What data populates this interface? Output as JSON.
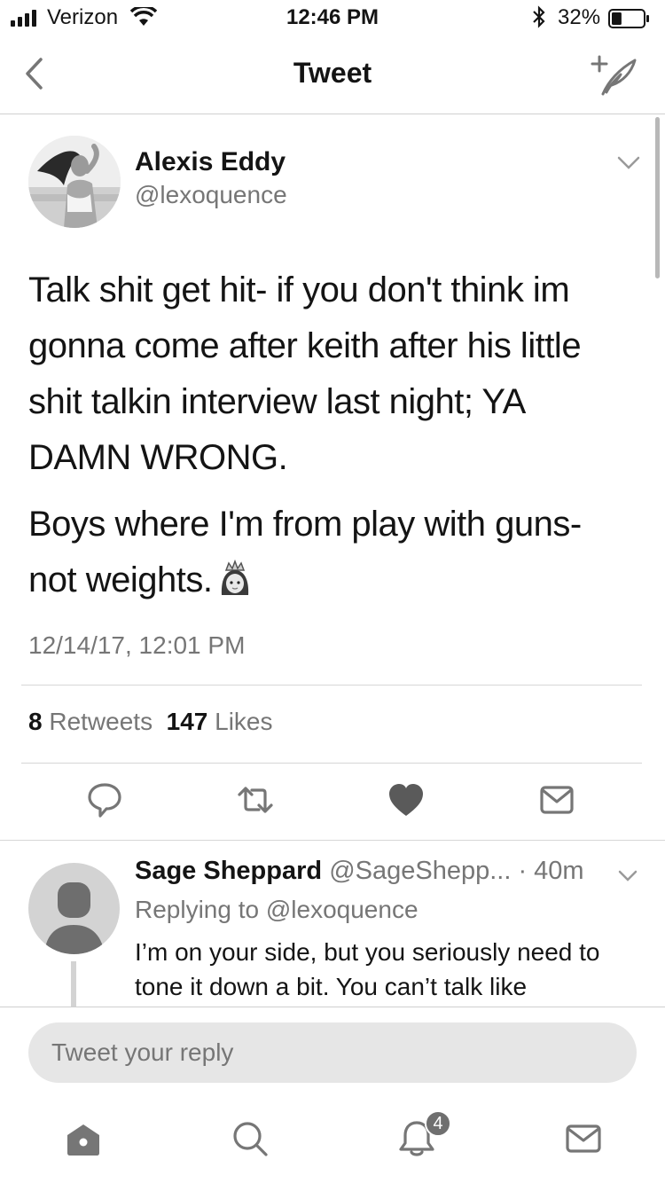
{
  "status_bar": {
    "carrier": "Verizon",
    "time": "12:46 PM",
    "battery_percent": "32%",
    "battery_level": 0.32
  },
  "nav": {
    "title": "Tweet",
    "icons": [
      "back-chevron-icon",
      "compose-tweet-icon"
    ]
  },
  "tweet": {
    "author_name": "Alexis Eddy",
    "author_handle": "@lexoquence",
    "text_p1": "Talk shit get hit- if you don't think im gonna come after keith after his little shit talkin interview last night; YA DAMN WRONG.",
    "text_p2": "Boys where I'm from play with guns- not weights.",
    "emoji": "princess-emoji",
    "timestamp": "12/14/17, 12:01 PM",
    "retweets_count": "8",
    "retweets_label": "Retweets",
    "likes_count": "147",
    "likes_label": "Likes",
    "actions": [
      "reply-icon",
      "retweet-icon",
      "like-heart-icon",
      "direct-message-icon"
    ]
  },
  "reply": {
    "name": "Sage Sheppard",
    "handle": "@SageShepp...",
    "time": "· 40m",
    "replying_to": "Replying to @lexoquence",
    "text": "I’m on your side, but you seriously need to tone it down a bit. You can’t talk like"
  },
  "compose": {
    "placeholder": "Tweet your reply"
  },
  "tabs": {
    "items": [
      "home-icon",
      "search-icon",
      "notifications-bell-icon",
      "messages-icon"
    ],
    "notifications_badge": "4"
  }
}
